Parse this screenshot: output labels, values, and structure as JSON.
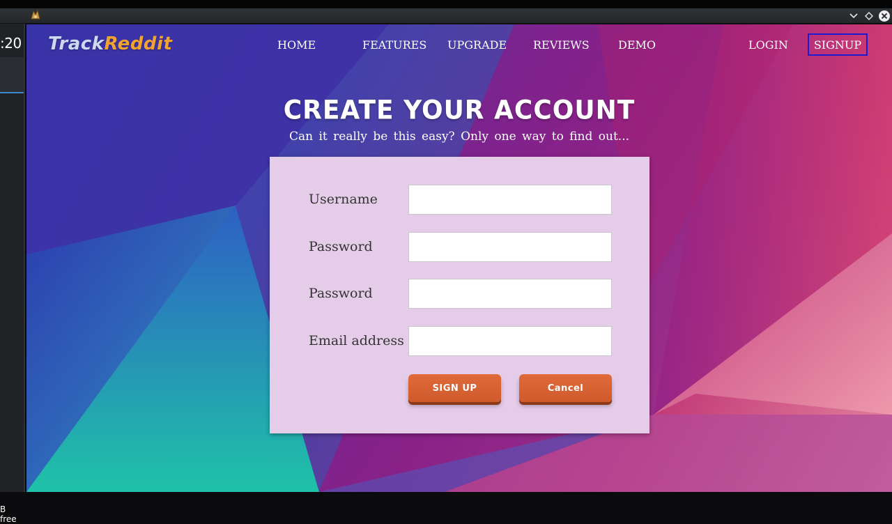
{
  "desktop": {
    "clock": ":20",
    "free_label": "B free"
  },
  "site": {
    "logo_part1": "Track",
    "logo_part2": "Reddit",
    "nav": {
      "home": "HOME",
      "features": "FEATURES",
      "upgrade": "UPGRADE",
      "reviews": "REVIEWS",
      "demo": "DEMO",
      "login": "LOGIN",
      "signup": "SIGNUP"
    },
    "headline": "CREATE YOUR ACCOUNT",
    "subhead": "Can it really be this easy? Only one way to find out...",
    "form": {
      "username_label": "Username",
      "password_label": "Password",
      "password_confirm_label": "Password",
      "email_label": "Email address",
      "username_value": "",
      "password_value": "",
      "password_confirm_value": "",
      "email_value": "",
      "signup_button": "SIGN UP",
      "cancel_button": "Cancel"
    }
  },
  "colors": {
    "logo_primary": "#cfd8f2",
    "logo_accent": "#f0a330",
    "card_bg": "#e5cce9",
    "button": "#d9602f",
    "signup_border": "#1a1ad0"
  }
}
